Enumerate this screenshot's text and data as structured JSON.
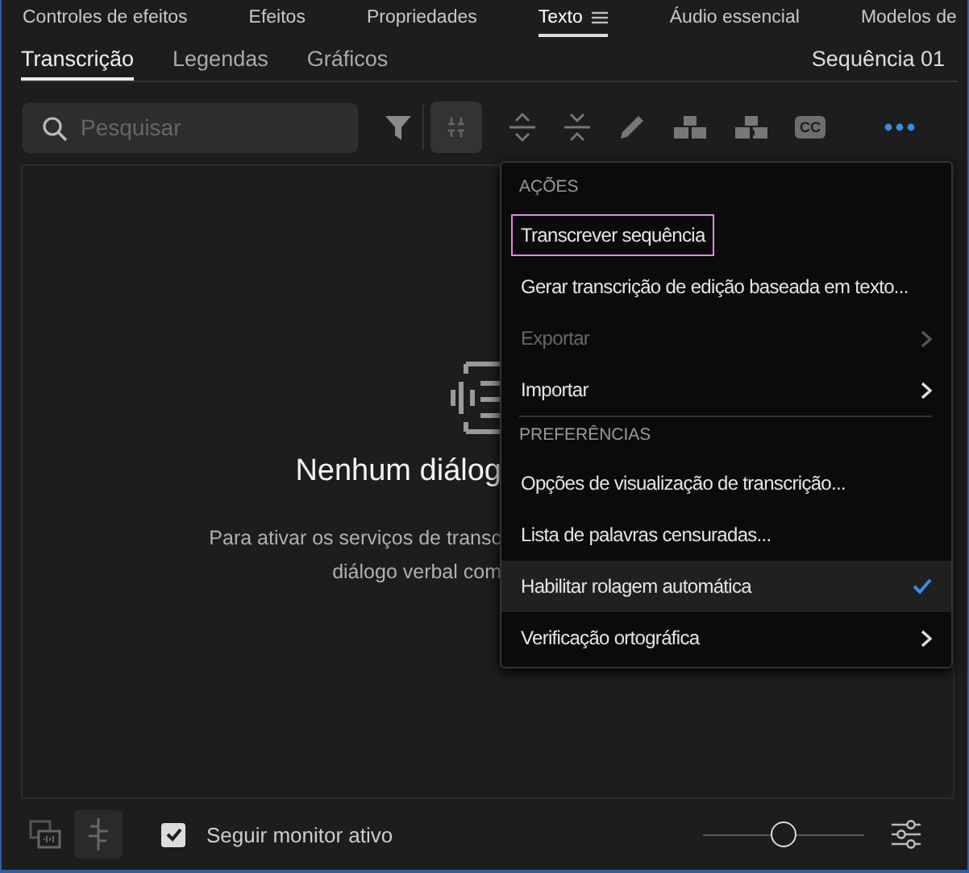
{
  "panel_tabs": [
    {
      "label": "Controles de efeitos",
      "selected": false
    },
    {
      "label": "Efeitos",
      "selected": false
    },
    {
      "label": "Propriedades",
      "selected": false
    },
    {
      "label": "Texto",
      "selected": true
    },
    {
      "label": "Áudio essencial",
      "selected": false
    },
    {
      "label": "Modelos de",
      "selected": false
    }
  ],
  "sub_tabs": [
    {
      "label": "Transcrição",
      "selected": true
    },
    {
      "label": "Legendas",
      "selected": false
    },
    {
      "label": "Gráficos",
      "selected": false
    }
  ],
  "sequence_name": "Sequência 01",
  "search": {
    "placeholder": "Pesquisar"
  },
  "toolbar": {
    "cc_label": "CC"
  },
  "empty_state": {
    "title": "Nenhum diálog",
    "description_lines": [
      "Para ativar os serviços de transc",
      "diálogo verbal com"
    ]
  },
  "menu": [
    {
      "kind": "header",
      "label": "AÇÕES"
    },
    {
      "kind": "item",
      "label": "Transcrever sequência",
      "focused": true,
      "disabled": false,
      "hovered": false,
      "submenu": false,
      "checked": false
    },
    {
      "kind": "item",
      "label": "Gerar transcrição de edição baseada em texto...",
      "focused": false,
      "disabled": false,
      "hovered": false,
      "submenu": false,
      "checked": false
    },
    {
      "kind": "item",
      "label": "Exportar",
      "focused": false,
      "disabled": true,
      "hovered": false,
      "submenu": true,
      "checked": false
    },
    {
      "kind": "item",
      "label": "Importar",
      "focused": false,
      "disabled": false,
      "hovered": false,
      "submenu": true,
      "checked": false
    },
    {
      "kind": "divider"
    },
    {
      "kind": "header",
      "label": "PREFERÊNCIAS"
    },
    {
      "kind": "item",
      "label": "Opções de visualização de transcrição...",
      "focused": false,
      "disabled": false,
      "hovered": false,
      "submenu": false,
      "checked": false
    },
    {
      "kind": "item",
      "label": "Lista de palavras censuradas...",
      "focused": false,
      "disabled": false,
      "hovered": false,
      "submenu": false,
      "checked": false
    },
    {
      "kind": "item",
      "label": "Habilitar rolagem automática",
      "focused": false,
      "disabled": false,
      "hovered": true,
      "submenu": false,
      "checked": true
    },
    {
      "kind": "item",
      "label": "Verificação ortográfica",
      "focused": false,
      "disabled": false,
      "hovered": false,
      "submenu": true,
      "checked": false
    }
  ],
  "footer": {
    "follow_monitor": {
      "label": "Seguir monitor ativo",
      "checked": true
    },
    "zoom": {
      "level": 0.5
    }
  }
}
